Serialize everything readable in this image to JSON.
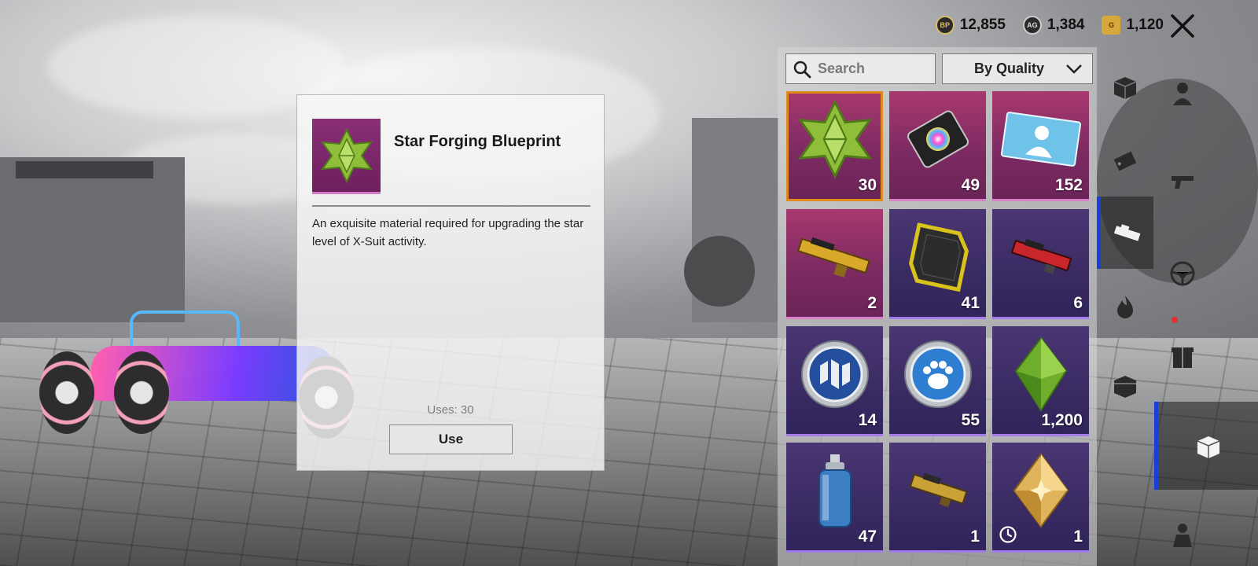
{
  "currencies": [
    {
      "icon": "bp-coin-icon",
      "value": "12,855"
    },
    {
      "icon": "ag-coin-icon",
      "value": "1,384"
    },
    {
      "icon": "uc-coin-icon",
      "value": "1,120"
    }
  ],
  "detail": {
    "title": "Star Forging Blueprint",
    "description": "An exquisite material required for upgrading the star level of X-Suit activity.",
    "uses": "Uses: 30",
    "use_button": "Use"
  },
  "inventory": {
    "search_placeholder": "Search",
    "sort_label": "By Quality",
    "items": [
      {
        "icon": "star-forging-blueprint-icon",
        "count": "30",
        "quality": "pink",
        "selected": true
      },
      {
        "icon": "color-palette-card-icon",
        "count": "49",
        "quality": "pink"
      },
      {
        "icon": "character-card-icon",
        "count": "152",
        "quality": "pink"
      },
      {
        "icon": "gold-gun-part-icon",
        "count": "2",
        "quality": "pink"
      },
      {
        "icon": "gold-frame-material-icon",
        "count": "41",
        "quality": "purple"
      },
      {
        "icon": "red-gun-part-icon",
        "count": "6",
        "quality": "purple"
      },
      {
        "icon": "blue-emblem-coin-icon",
        "count": "14",
        "quality": "purple"
      },
      {
        "icon": "paw-coin-icon",
        "count": "55",
        "quality": "purple"
      },
      {
        "icon": "green-crystal-icon",
        "count": "1,200",
        "quality": "purple"
      },
      {
        "icon": "spray-can-icon",
        "count": "47",
        "quality": "purple"
      },
      {
        "icon": "gold-scope-part-icon",
        "count": "1",
        "quality": "purple"
      },
      {
        "icon": "gold-crystal-icon",
        "count": "1",
        "quality": "purple",
        "timer": true
      }
    ]
  },
  "sidebar": {
    "tabs": [
      {
        "icon": "crate-icon"
      },
      {
        "icon": "character-icon"
      },
      {
        "icon": "tag-icon"
      },
      {
        "icon": "gun-icon"
      },
      {
        "icon": "item-tool-icon"
      },
      {
        "icon": "steering-wheel-icon"
      },
      {
        "icon": "fire-icon"
      },
      {
        "icon": "gift-box-icon"
      },
      {
        "icon": "supply-box-icon"
      },
      {
        "icon": "materials-box-icon"
      },
      {
        "icon": "outfit-icon"
      }
    ]
  },
  "colors": {
    "quality_pink": "#8a2f78",
    "quality_purple": "#3a2b63",
    "selection": "#e08a1e",
    "active_tab": "#1a3fd8"
  }
}
